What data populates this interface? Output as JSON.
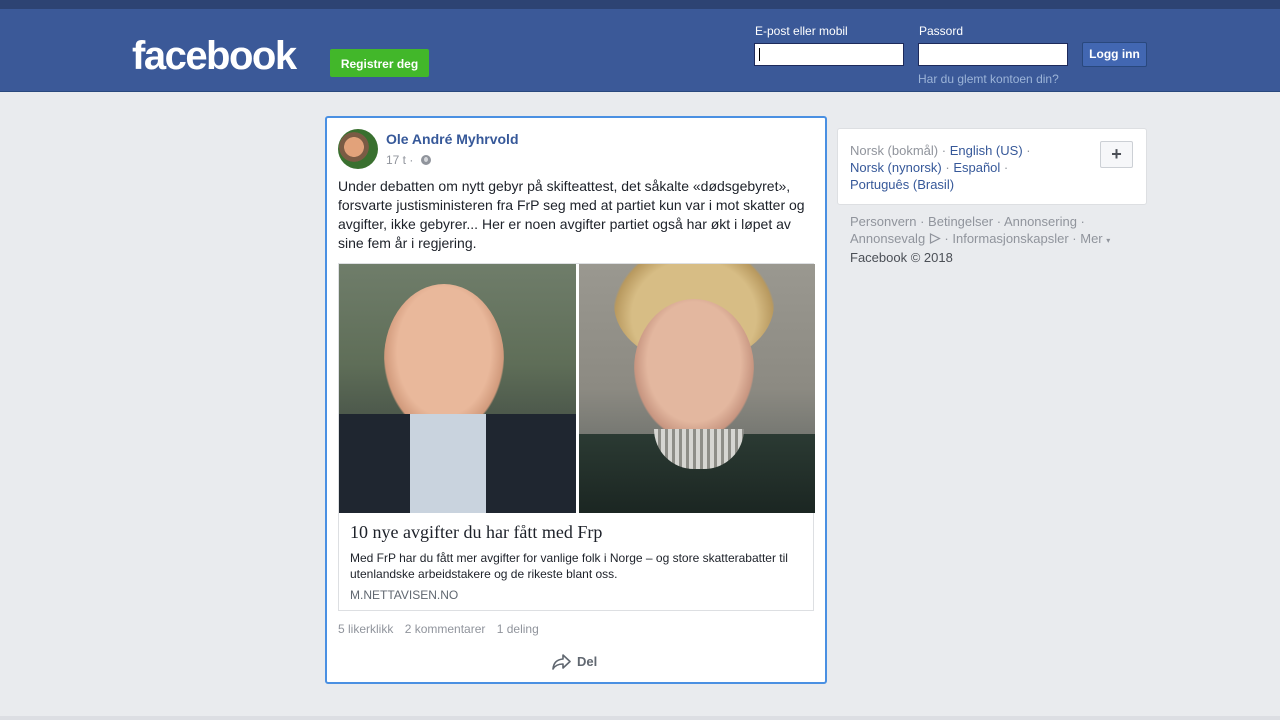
{
  "header": {
    "logo_text": "facebook",
    "register_label": "Registrer deg",
    "email_label": "E-post eller mobil",
    "password_label": "Passord",
    "login_label": "Logg inn",
    "forgot_label": "Har du glemt kontoen din?"
  },
  "post": {
    "author": "Ole André Myhrvold",
    "time": "17 t ·",
    "text": "Under debatten om nytt gebyr på skifteattest, det såkalte «dødsgebyret», forsvarte justisministeren fra FrP seg med at partiet kun var i mot skatter og avgifter, ikke gebyrer... Her er noen avgifter partiet også har økt i løpet av sine fem år i regjering.",
    "link": {
      "title": "10 nye avgifter du har fått med Frp",
      "description": "Med FrP har du fått mer avgifter for vanlige folk i Norge – og store skatterabatter til utenlandske arbeidstakere og de rikeste blant oss.",
      "domain": "M.NETTAVISEN.NO"
    },
    "stats": {
      "likes": "5 likerklikk",
      "comments": "2 kommentarer",
      "shares": "1 deling"
    },
    "share_label": "Del"
  },
  "sidebar": {
    "languages": [
      {
        "label": "Norsk (bokmål)",
        "current": true
      },
      {
        "label": "English (US)",
        "current": false
      },
      {
        "label": "Norsk (nynorsk)",
        "current": false
      },
      {
        "label": "Español",
        "current": false
      },
      {
        "label": "Português (Brasil)",
        "current": false
      }
    ],
    "plus_label": "+",
    "footer": {
      "privacy": "Personvern",
      "terms": "Betingelser",
      "advertising": "Annonsering",
      "ad_choices": "Annonsevalg",
      "cookies": "Informasjonskapsler",
      "more": "Mer",
      "copyright": "Facebook © 2018"
    }
  },
  "colors": {
    "header_bg": "#3b5998",
    "link_blue": "#365899",
    "register_green": "#42b72a",
    "focus_border": "#4a90e2"
  }
}
